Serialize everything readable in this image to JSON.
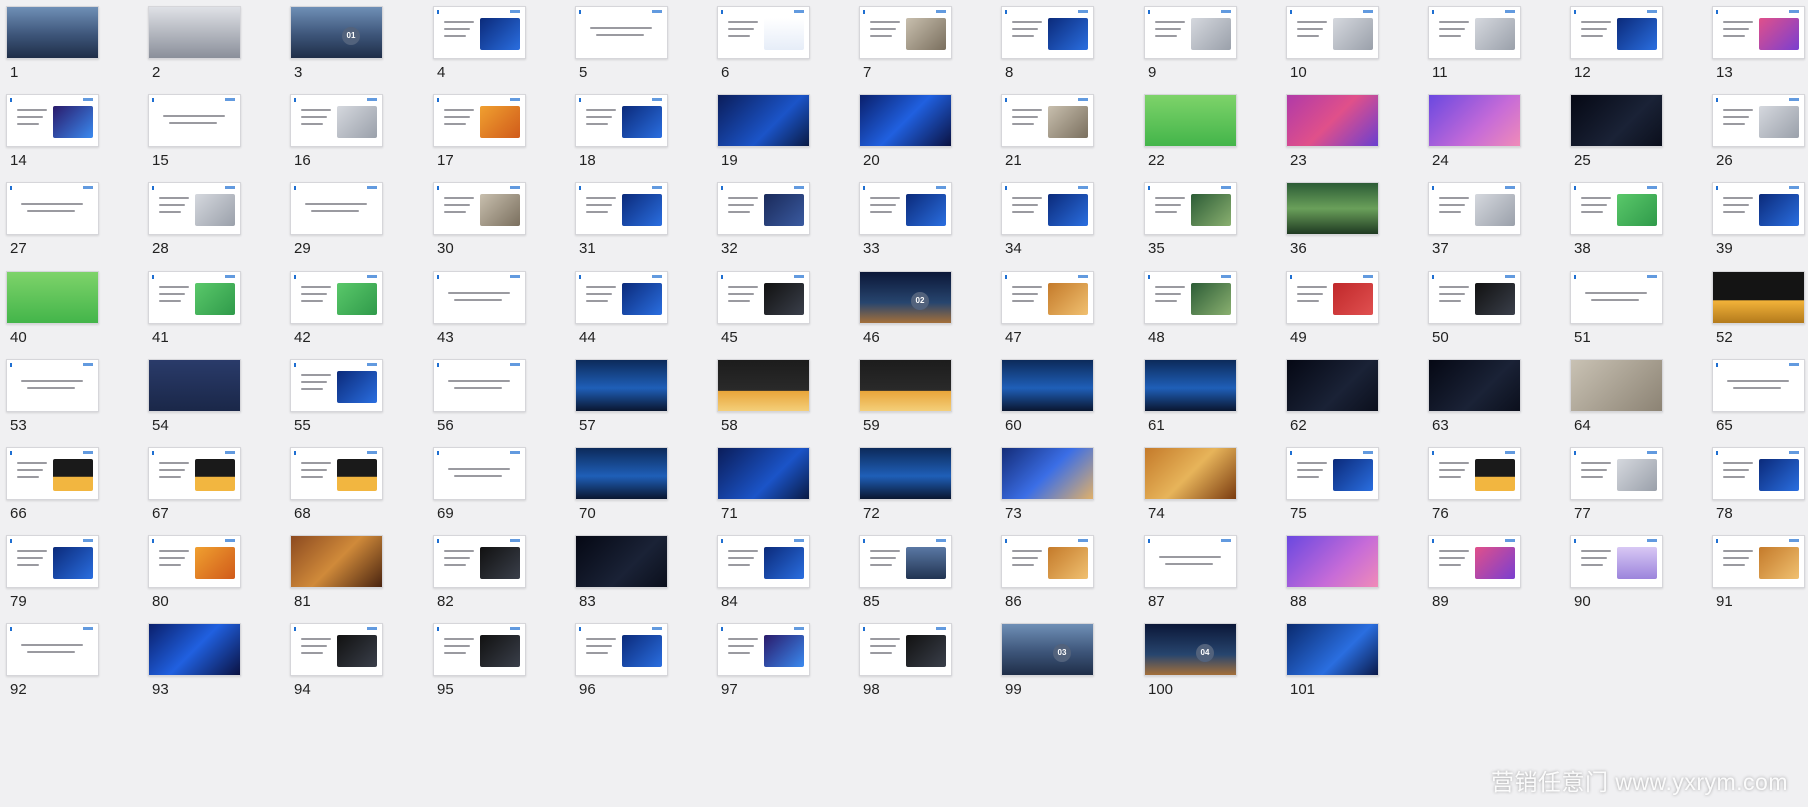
{
  "slides": [
    {
      "n": "1",
      "theme": "city"
    },
    {
      "n": "2",
      "theme": "gray"
    },
    {
      "n": "3",
      "theme": "city",
      "badge": "01"
    },
    {
      "n": "4",
      "theme": "white",
      "img": "blue"
    },
    {
      "n": "5",
      "theme": "white"
    },
    {
      "n": "6",
      "theme": "white",
      "img": "chart"
    },
    {
      "n": "7",
      "theme": "white",
      "img": "office"
    },
    {
      "n": "8",
      "theme": "white",
      "img": "blue"
    },
    {
      "n": "9",
      "theme": "white",
      "img": "gray"
    },
    {
      "n": "10",
      "theme": "white",
      "img": "gray"
    },
    {
      "n": "11",
      "theme": "white",
      "img": "gray"
    },
    {
      "n": "12",
      "theme": "white",
      "img": "blue"
    },
    {
      "n": "13",
      "theme": "white",
      "img": "pink"
    },
    {
      "n": "14",
      "theme": "white",
      "img": "neon"
    },
    {
      "n": "15",
      "theme": "white"
    },
    {
      "n": "16",
      "theme": "white",
      "img": "gray"
    },
    {
      "n": "17",
      "theme": "white",
      "img": "orange"
    },
    {
      "n": "18",
      "theme": "white",
      "img": "blue"
    },
    {
      "n": "19",
      "theme": "blue"
    },
    {
      "n": "20",
      "theme": "neon"
    },
    {
      "n": "21",
      "theme": "white",
      "img": "office"
    },
    {
      "n": "22",
      "theme": "green"
    },
    {
      "n": "23",
      "theme": "pink"
    },
    {
      "n": "24",
      "theme": "purple"
    },
    {
      "n": "25",
      "theme": "dark"
    },
    {
      "n": "26",
      "theme": "white",
      "img": "gray"
    },
    {
      "n": "27",
      "theme": "white"
    },
    {
      "n": "28",
      "theme": "white",
      "img": "gray"
    },
    {
      "n": "29",
      "theme": "white"
    },
    {
      "n": "30",
      "theme": "white",
      "img": "office"
    },
    {
      "n": "31",
      "theme": "white",
      "img": "blue"
    },
    {
      "n": "32",
      "theme": "white",
      "img": "navy"
    },
    {
      "n": "33",
      "theme": "white",
      "img": "blue"
    },
    {
      "n": "34",
      "theme": "white",
      "img": "blue"
    },
    {
      "n": "35",
      "theme": "white",
      "img": "forest"
    },
    {
      "n": "36",
      "theme": "forest"
    },
    {
      "n": "37",
      "theme": "white",
      "img": "gray"
    },
    {
      "n": "38",
      "theme": "white",
      "img": "green"
    },
    {
      "n": "39",
      "theme": "white",
      "img": "blue"
    },
    {
      "n": "40",
      "theme": "green"
    },
    {
      "n": "41",
      "theme": "white",
      "img": "green"
    },
    {
      "n": "42",
      "theme": "white",
      "img": "green"
    },
    {
      "n": "43",
      "theme": "white"
    },
    {
      "n": "44",
      "theme": "white",
      "img": "blue"
    },
    {
      "n": "45",
      "theme": "white",
      "img": "dark"
    },
    {
      "n": "46",
      "theme": "night",
      "badge": "02"
    },
    {
      "n": "47",
      "theme": "white",
      "img": "food"
    },
    {
      "n": "48",
      "theme": "white",
      "img": "forest"
    },
    {
      "n": "49",
      "theme": "white",
      "img": "red"
    },
    {
      "n": "50",
      "theme": "white",
      "img": "dark"
    },
    {
      "n": "51",
      "theme": "white"
    },
    {
      "n": "52",
      "theme": "moon"
    },
    {
      "n": "53",
      "theme": "white"
    },
    {
      "n": "54",
      "theme": "navy"
    },
    {
      "n": "55",
      "theme": "white",
      "img": "blue"
    },
    {
      "n": "56",
      "theme": "white"
    },
    {
      "n": "57",
      "theme": "stage"
    },
    {
      "n": "58",
      "theme": "golden"
    },
    {
      "n": "59",
      "theme": "golden"
    },
    {
      "n": "60",
      "theme": "stage"
    },
    {
      "n": "61",
      "theme": "stage"
    },
    {
      "n": "62",
      "theme": "dark"
    },
    {
      "n": "63",
      "theme": "dark"
    },
    {
      "n": "64",
      "theme": "office"
    },
    {
      "n": "65",
      "theme": "white"
    },
    {
      "n": "66",
      "theme": "white",
      "img": "moon"
    },
    {
      "n": "67",
      "theme": "white",
      "img": "moon"
    },
    {
      "n": "68",
      "theme": "white",
      "img": "moon"
    },
    {
      "n": "69",
      "theme": "white"
    },
    {
      "n": "70",
      "theme": "stage"
    },
    {
      "n": "71",
      "theme": "blue"
    },
    {
      "n": "72",
      "theme": "stage"
    },
    {
      "n": "73",
      "theme": "party"
    },
    {
      "n": "74",
      "theme": "food"
    },
    {
      "n": "75",
      "theme": "white",
      "img": "blue"
    },
    {
      "n": "76",
      "theme": "white",
      "img": "moon"
    },
    {
      "n": "77",
      "theme": "white",
      "img": "gray"
    },
    {
      "n": "78",
      "theme": "white",
      "img": "blue"
    },
    {
      "n": "79",
      "theme": "white",
      "img": "blue"
    },
    {
      "n": "80",
      "theme": "white",
      "img": "orange"
    },
    {
      "n": "81",
      "theme": "warm"
    },
    {
      "n": "82",
      "theme": "white",
      "img": "dark"
    },
    {
      "n": "83",
      "theme": "dark"
    },
    {
      "n": "84",
      "theme": "white",
      "img": "blue"
    },
    {
      "n": "85",
      "theme": "white",
      "img": "city"
    },
    {
      "n": "86",
      "theme": "white",
      "img": "food"
    },
    {
      "n": "87",
      "theme": "white"
    },
    {
      "n": "88",
      "theme": "purple"
    },
    {
      "n": "89",
      "theme": "white",
      "img": "pink"
    },
    {
      "n": "90",
      "theme": "white",
      "img": "lilac"
    },
    {
      "n": "91",
      "theme": "white",
      "img": "food"
    },
    {
      "n": "92",
      "theme": "white"
    },
    {
      "n": "93",
      "theme": "neon"
    },
    {
      "n": "94",
      "theme": "white",
      "img": "dark"
    },
    {
      "n": "95",
      "theme": "white",
      "img": "dark"
    },
    {
      "n": "96",
      "theme": "white",
      "img": "blue"
    },
    {
      "n": "97",
      "theme": "white",
      "img": "neon"
    },
    {
      "n": "98",
      "theme": "white",
      "img": "dark"
    },
    {
      "n": "99",
      "theme": "city",
      "badge": "03"
    },
    {
      "n": "100",
      "theme": "night",
      "badge": "04"
    },
    {
      "n": "101",
      "theme": "thanks"
    }
  ],
  "watermark": "营销任意门  www.yxrym.com"
}
